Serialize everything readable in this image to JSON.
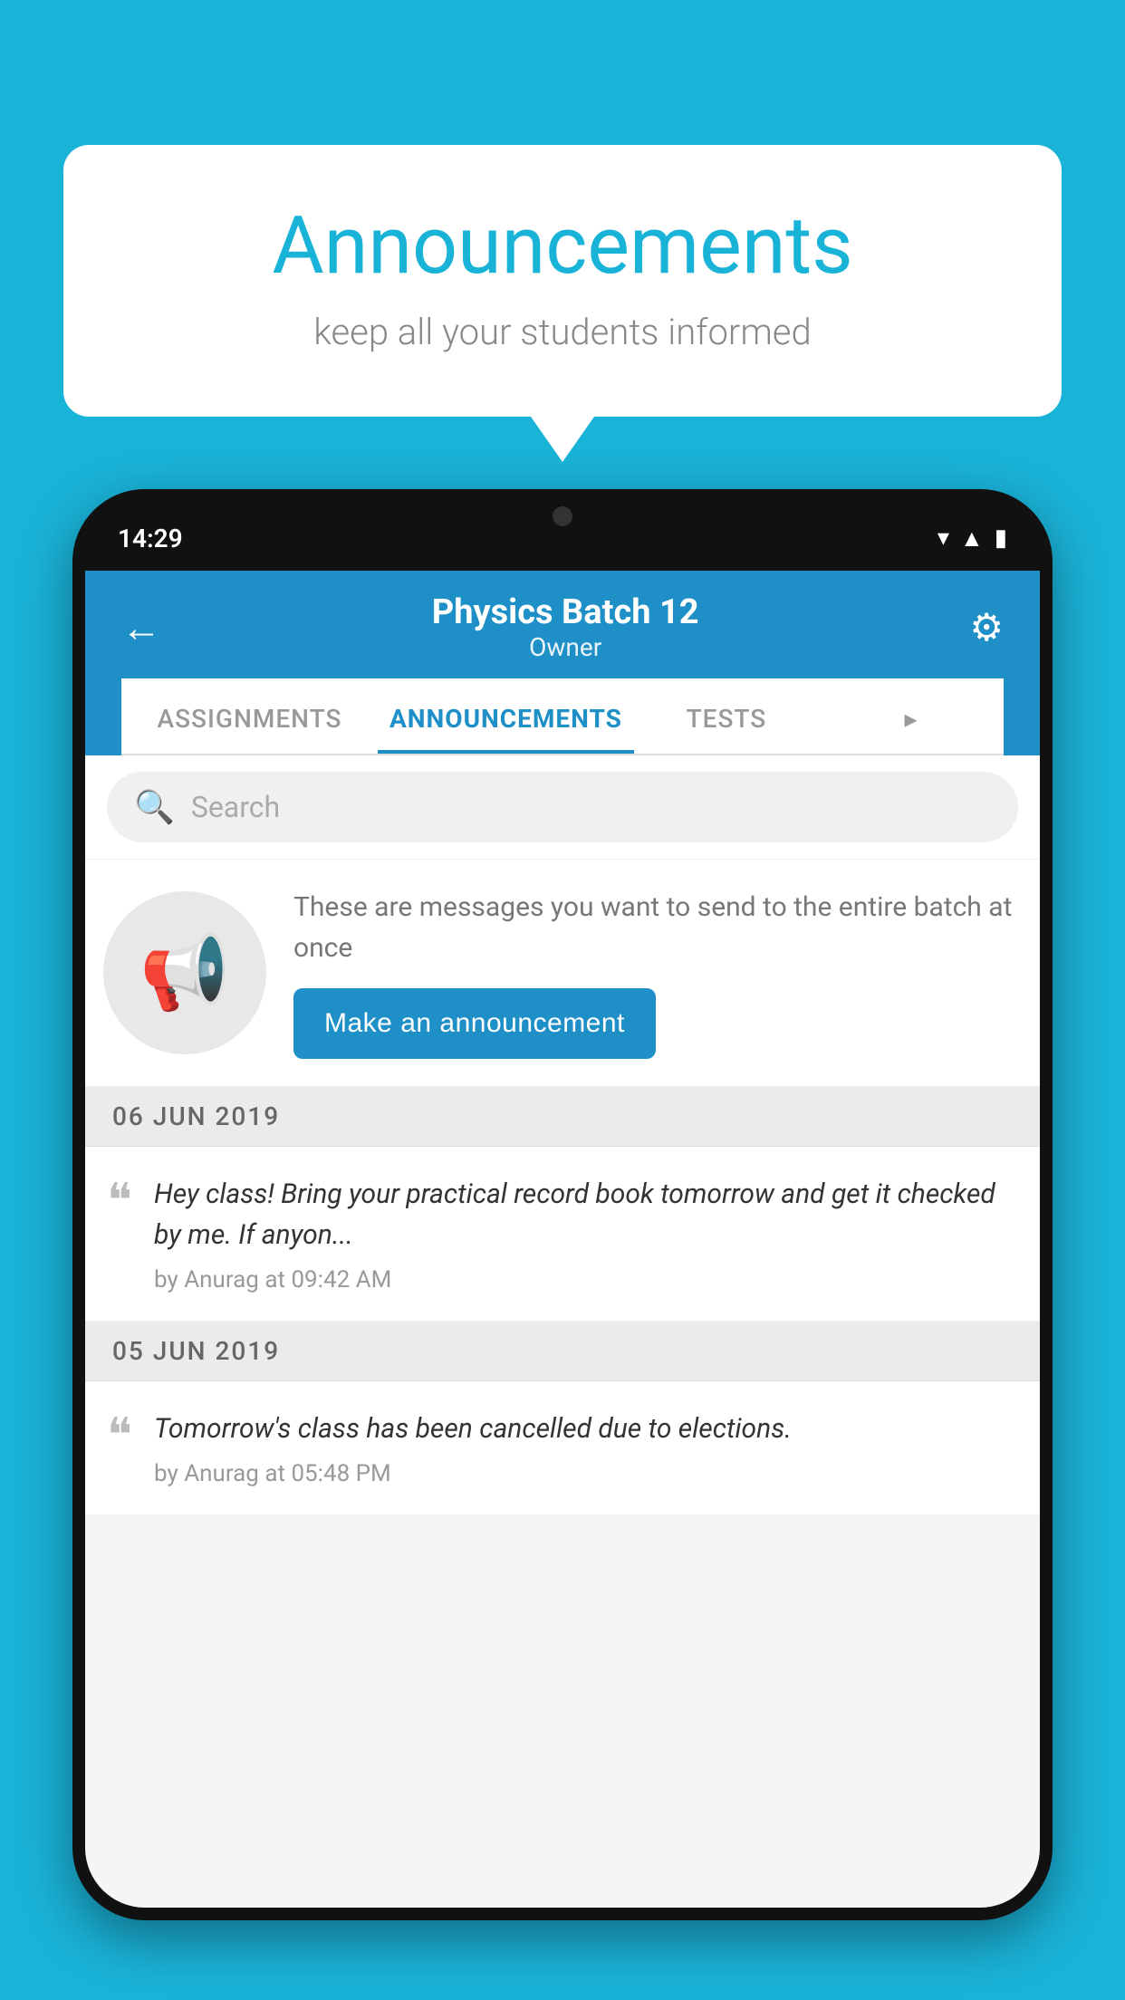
{
  "background_color": "#1ab3d8",
  "speech_bubble": {
    "title": "Announcements",
    "subtitle": "keep all your students informed"
  },
  "phone": {
    "status_bar": {
      "time": "14:29",
      "icons": [
        "wifi",
        "signal",
        "battery"
      ]
    },
    "header": {
      "title": "Physics Batch 12",
      "subtitle": "Owner",
      "back_label": "←",
      "gear_label": "⚙"
    },
    "tabs": [
      {
        "label": "ASSIGNMENTS",
        "active": false
      },
      {
        "label": "ANNOUNCEMENTS",
        "active": true
      },
      {
        "label": "TESTS",
        "active": false
      },
      {
        "label": "▸",
        "active": false
      }
    ],
    "search": {
      "placeholder": "Search"
    },
    "promo_card": {
      "description": "These are messages you want to send to the entire batch at once",
      "button_label": "Make an announcement"
    },
    "announcements": [
      {
        "date": "06  JUN  2019",
        "text": "Hey class! Bring your practical record book tomorrow and get it checked by me. If anyon...",
        "meta": "by Anurag at 09:42 AM"
      },
      {
        "date": "05  JUN  2019",
        "text": "Tomorrow's class has been cancelled due to elections.",
        "meta": "by Anurag at 05:48 PM"
      }
    ]
  }
}
